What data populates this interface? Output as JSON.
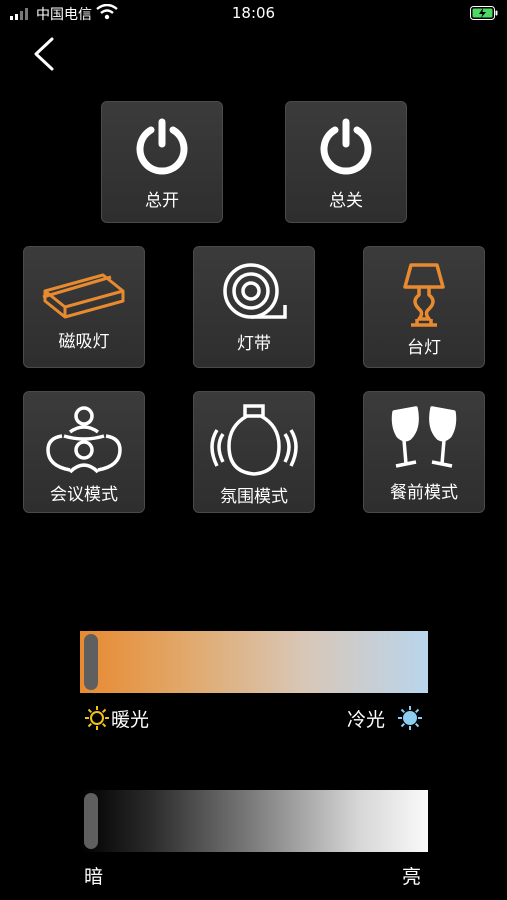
{
  "status_bar": {
    "carrier": "中国电信",
    "time": "18:06"
  },
  "tiles": {
    "all_on": "总开",
    "all_off": "总关",
    "magnetic_light": "磁吸灯",
    "light_strip": "灯带",
    "desk_lamp": "台灯",
    "meeting_mode": "会议模式",
    "ambience_mode": "氛围模式",
    "dining_mode": "餐前模式"
  },
  "color_temperature": {
    "warm_label": "暖光",
    "cool_label": "冷光",
    "level": 0.0
  },
  "brightness": {
    "dark_label": "暗",
    "bright_label": "亮",
    "level": 0.0
  },
  "colors": {
    "accent_orange": "#e88a30",
    "sun_yellow": "#f2c31b",
    "sun_blue": "#8ccdf0",
    "tile_bg": "#333333"
  }
}
